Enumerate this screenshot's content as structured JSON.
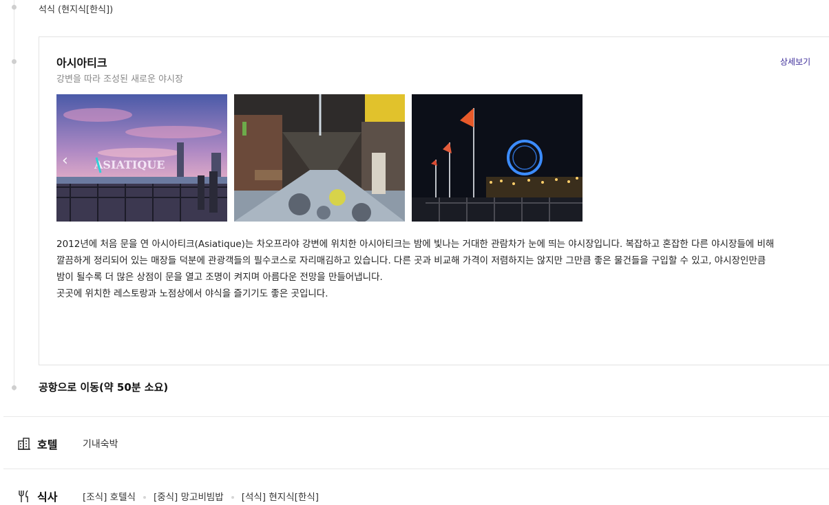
{
  "timeline": {
    "dinner_note": "석식 (현지식[한식])",
    "transfer": "공항으로 이동(약 50분 소요)"
  },
  "spot": {
    "title": "아시아티크",
    "subtitle": "강변을 따라 조성된 새로운 야시장",
    "detail_label": "상세보기",
    "photos": [
      "asiatique-riverside-sign-photo",
      "market-walkway-photo",
      "ferris-wheel-night-photo"
    ],
    "description": [
      "2012년에 처음 문을 연 아시아티크(Asiatique)는 차오프라야 강변에 위치한 아시아티크는 밤에 빛나는 거대한 관람차가 눈에 띄는 야시장입니다. 복잡하고 혼잡한 다른 야시장들에 비해",
      "깔끔하게 정리되어 있는 매장들 덕분에 관광객들의 필수코스로 자리매김하고 있습니다. 다른 곳과 비교해 가격이 저렴하지는 않지만 그만큼 좋은 물건들을 구입할 수 있고, 야시장인만큼",
      "밤이 될수록 더 많은 상점이 문을 열고 조명이 켜지며 아름다운 전망을 만들어냅니다.",
      "곳곳에 위치한 레스토랑과 노점상에서 야식을 즐기기도 좋은 곳입니다."
    ]
  },
  "hotel": {
    "icon": "building-icon",
    "label": "호텔",
    "value": "기내숙박"
  },
  "meals": {
    "icon": "fork-knife-icon",
    "label": "식사",
    "items": [
      "[조식] 호텔식",
      "[중식] 망고비빔밥",
      "[석식] 현지식[한식]"
    ]
  },
  "colors": {
    "accent_link": "#3d2d9a",
    "timeline_dot": "#cfcfcf",
    "divider": "#e8e8e8"
  }
}
